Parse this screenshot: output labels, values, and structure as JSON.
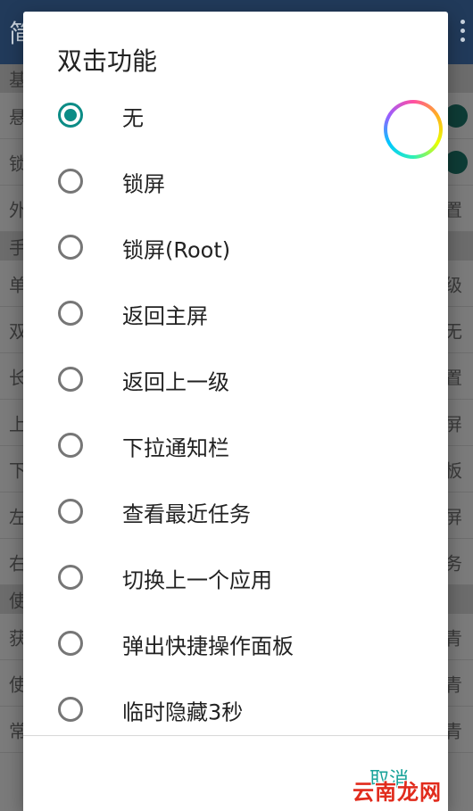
{
  "background": {
    "appbar_title": "简",
    "rows": [
      {
        "type": "section",
        "left": "基",
        "right": ""
      },
      {
        "type": "item",
        "left": "悬",
        "right": "",
        "toggle": true
      },
      {
        "type": "item",
        "left": "锁",
        "right": "",
        "toggle": true
      },
      {
        "type": "item",
        "left": "外",
        "right": "置"
      },
      {
        "type": "section",
        "left": "手",
        "right": ""
      },
      {
        "type": "item",
        "left": "单",
        "right": "级"
      },
      {
        "type": "item",
        "left": "双",
        "right": "无"
      },
      {
        "type": "item",
        "left": "长",
        "right": "置"
      },
      {
        "type": "item",
        "left": "上",
        "right": "屏"
      },
      {
        "type": "item",
        "left": "下",
        "right": "板"
      },
      {
        "type": "item",
        "left": "左",
        "right": "屏"
      },
      {
        "type": "item",
        "left": "右",
        "right": "务"
      },
      {
        "type": "section",
        "left": "使",
        "right": ""
      },
      {
        "type": "item",
        "left": "获",
        "right": "青"
      },
      {
        "type": "item",
        "left": "使",
        "right": "青"
      },
      {
        "type": "item",
        "left": "常",
        "right": "青"
      }
    ]
  },
  "dialog": {
    "title": "双击功能",
    "options": [
      {
        "label": "无",
        "checked": true
      },
      {
        "label": "锁屏",
        "checked": false
      },
      {
        "label": "锁屏(Root)",
        "checked": false
      },
      {
        "label": "返回主屏",
        "checked": false
      },
      {
        "label": "返回上一级",
        "checked": false
      },
      {
        "label": "下拉通知栏",
        "checked": false
      },
      {
        "label": "查看最近任务",
        "checked": false
      },
      {
        "label": "切换上一个应用",
        "checked": false
      },
      {
        "label": "弹出快捷操作面板",
        "checked": false
      },
      {
        "label": "临时隐藏3秒",
        "checked": false
      }
    ],
    "cancel_label": "取消"
  },
  "watermark": "云南龙网",
  "colors": {
    "accent": "#0c8c86",
    "button_text": "#1aa39a",
    "watermark": "#e12b1c"
  }
}
